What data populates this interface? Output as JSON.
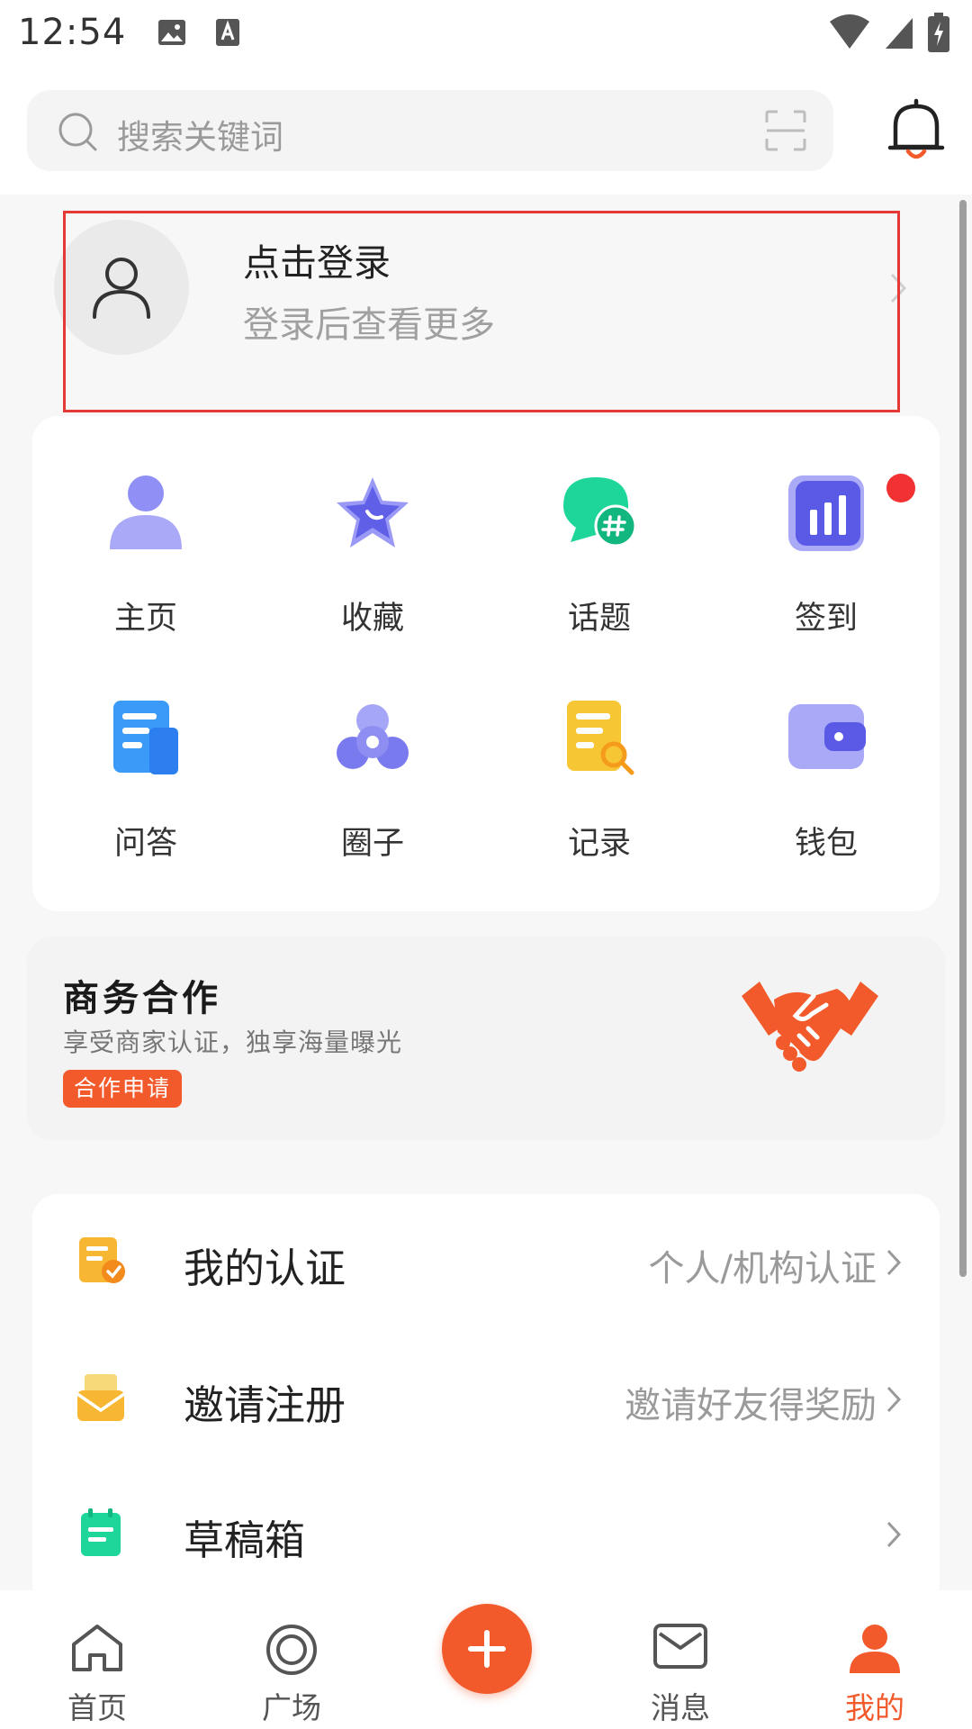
{
  "status_bar": {
    "time": "12:54"
  },
  "search": {
    "placeholder": "搜索关键词"
  },
  "login": {
    "title": "点击登录",
    "subtitle": "登录后查看更多"
  },
  "grid": {
    "items": [
      {
        "label": "主页",
        "icon": "user-profile-icon"
      },
      {
        "label": "收藏",
        "icon": "star-icon"
      },
      {
        "label": "话题",
        "icon": "topic-chat-icon"
      },
      {
        "label": "签到",
        "icon": "bar-chart-icon"
      },
      {
        "label": "问答",
        "icon": "document-icon"
      },
      {
        "label": "圈子",
        "icon": "circle-group-icon"
      },
      {
        "label": "记录",
        "icon": "record-search-icon"
      },
      {
        "label": "钱包",
        "icon": "wallet-icon"
      }
    ]
  },
  "business": {
    "title": "商务合作",
    "subtitle": "享受商家认证，独享海量曝光",
    "button": "合作申请"
  },
  "list": {
    "items": [
      {
        "label": "我的认证",
        "value": "个人/机构认证"
      },
      {
        "label": "邀请注册",
        "value": "邀请好友得奖励"
      },
      {
        "label": "草稿箱",
        "value": ""
      }
    ]
  },
  "nav": {
    "items": [
      {
        "label": "首页"
      },
      {
        "label": "广场"
      },
      {
        "label": "消息"
      },
      {
        "label": "我的"
      }
    ]
  },
  "colors": {
    "accent": "#f25a2c",
    "highlight_border": "#e53935",
    "badge": "#f23232",
    "purple": "#6f6ff2",
    "green": "#1ec28b",
    "blue": "#3b8cf6",
    "yellow": "#f7c634"
  }
}
